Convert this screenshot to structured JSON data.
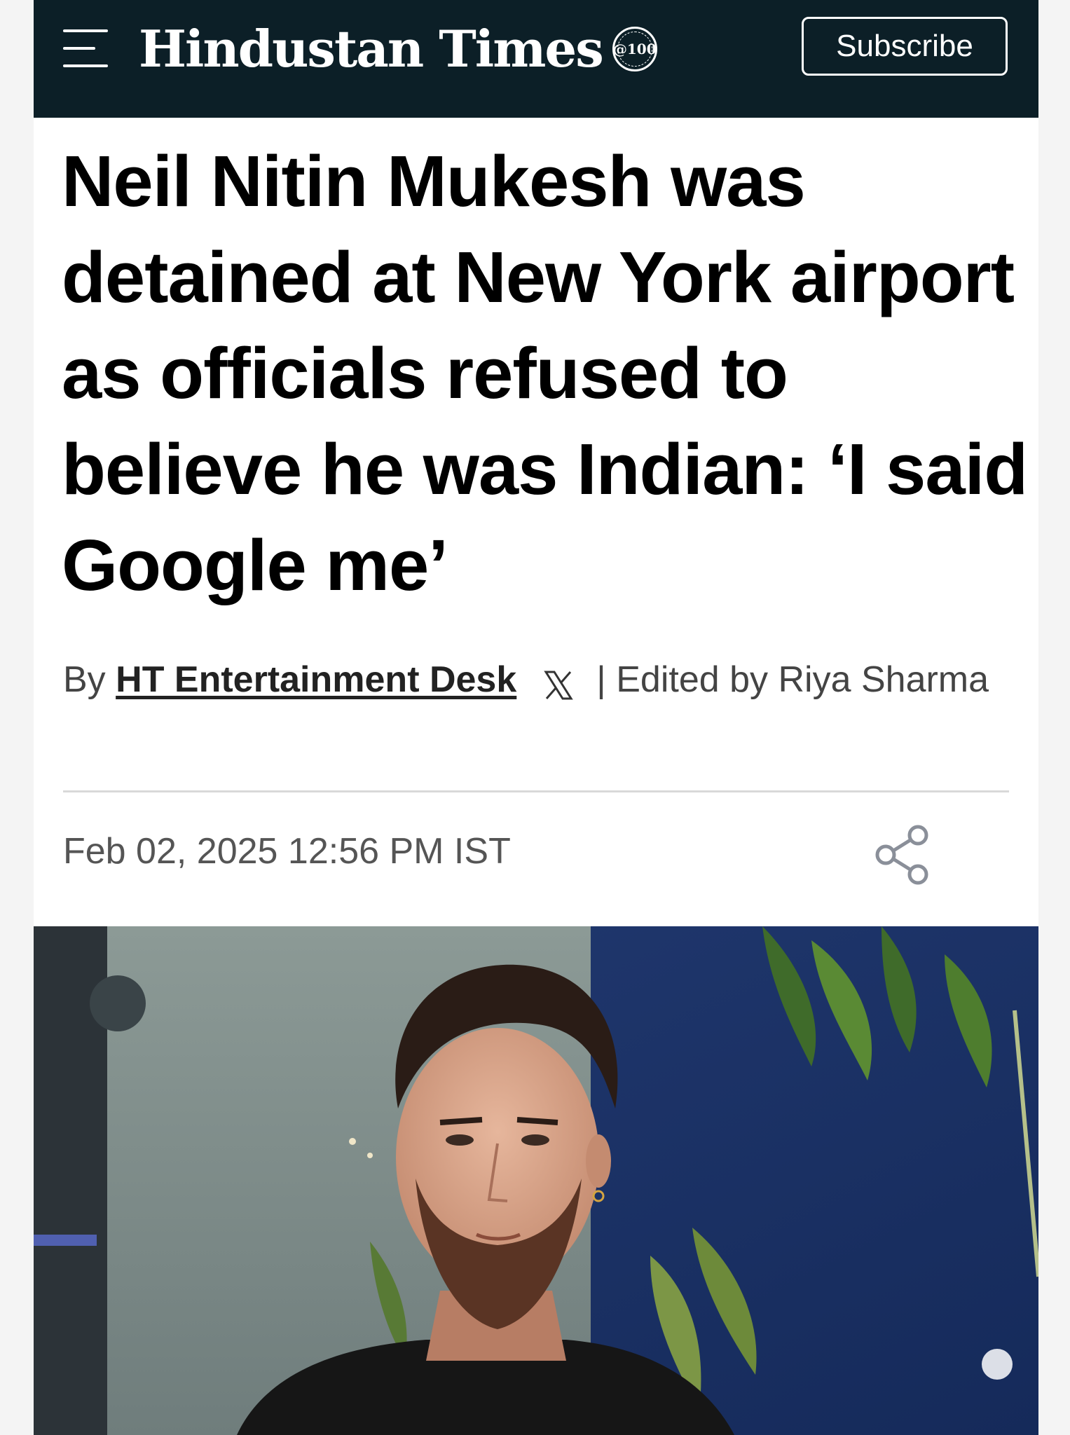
{
  "header": {
    "brand": "Hindustan Times",
    "seal_text": "@100",
    "subscribe_label": "Subscribe",
    "background_color": "#0c1f27"
  },
  "article": {
    "headline": "Neil Nitin Mukesh was detained at New York airport as officials refused to believe he was Indian: ‘I said Google me’",
    "byline_prefix": "By",
    "author": "HT Entertainment Desk",
    "edited_by": "| Edited by Riya Sharma",
    "timestamp": "Feb 02, 2025 12:56 PM IST"
  },
  "icons": {
    "menu": "hamburger-menu-icon",
    "x": "x-twitter-icon",
    "share": "share-icon"
  },
  "photo": {
    "subject": "man-portrait"
  }
}
